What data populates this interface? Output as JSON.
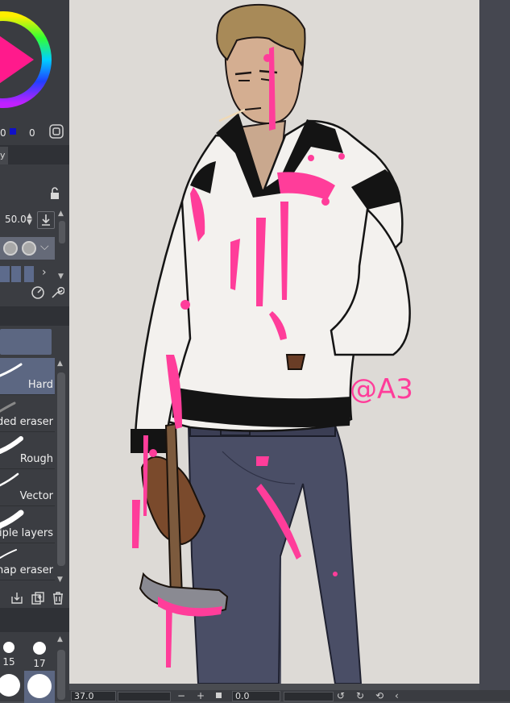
{
  "color_panel": {
    "value_a": "0",
    "value_b": "0",
    "accent_hue": "#ff1a8c"
  },
  "tabs": {
    "partial_tab_label": "y"
  },
  "tool_property": {
    "brush_size": "50.0"
  },
  "brushes": [
    {
      "label": "Hard",
      "selected": true
    },
    {
      "label": "ded eraser",
      "selected": false
    },
    {
      "label": "Rough",
      "selected": false
    },
    {
      "label": "Vector",
      "selected": false
    },
    {
      "label": "tiple layers",
      "selected": false
    },
    {
      "label": "nap eraser",
      "selected": false
    }
  ],
  "brush_tips": [
    {
      "label": "15"
    },
    {
      "label": "17"
    }
  ],
  "status": {
    "zoom": "37.0",
    "rotation": "0.0",
    "minus": "−",
    "plus": "+"
  },
  "artwork": {
    "signature": "@A3",
    "accent": "#ff3d9a",
    "jacket": "#f3f1ee",
    "jeans": "#4a4e66"
  }
}
